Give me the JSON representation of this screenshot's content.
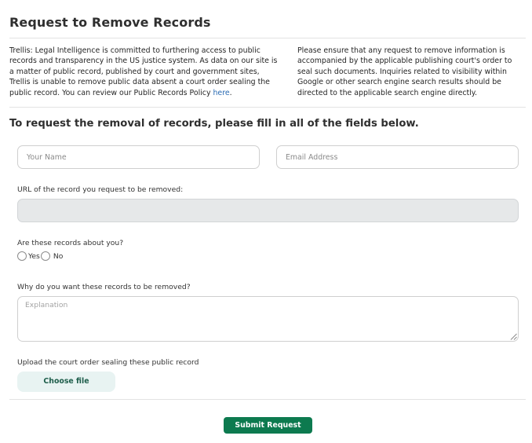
{
  "page": {
    "title": "Request to Remove Records"
  },
  "intro": {
    "left_text": "Trellis: Legal Intelligence is committed to furthering access to public records and transparency in the US justice system. As data on our site is a matter of public record, published by court and government sites, Trellis is unable to remove public data absent a court order sealing the public record. You can review our Public Records Policy ",
    "left_link": "here",
    "left_suffix": ".",
    "right_text": "Please ensure that any request to remove information is accompanied by the applicable publishing court's order to seal such documents. Inquiries related to visibility within Google or other search engine search results should be directed to the applicable search engine directly."
  },
  "form": {
    "heading": "To request the removal of records, please fill in all of the fields below.",
    "name_placeholder": "Your Name",
    "email_placeholder": "Email Address",
    "url_label": "URL of the record you request to be removed:",
    "url_value": "",
    "about_you_label": "Are these records about you?",
    "radio_yes": "Yes",
    "radio_no": "No",
    "why_label": "Why do you want these records to be removed?",
    "explanation_placeholder": "Explanation",
    "upload_label": "Upload the court order sealing these public record",
    "choose_file": "Choose file",
    "submit": "Submit Request"
  },
  "colors": {
    "link": "#2a6bb3",
    "submit_bg": "#0d7a4f",
    "file_button_bg": "#e8f3f2",
    "url_field_bg": "#e6e8e9"
  }
}
